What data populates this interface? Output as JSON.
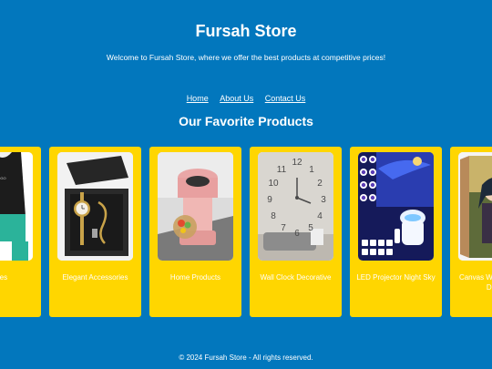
{
  "header": {
    "title": "Fursah Store",
    "tagline": "Welcome to Fursah Store, where we offer the best products at competitive prices!"
  },
  "nav": {
    "home": "Home",
    "about": "About Us",
    "contact": "Contact Us"
  },
  "products": {
    "heading": "Our Favorite Products",
    "items": [
      {
        "label": "Clothes",
        "image": "black-tank-top-photo"
      },
      {
        "label": "Elegant Accessories",
        "image": "gold-watch-gift-box-photo"
      },
      {
        "label": "Home Products",
        "image": "pink-blender-photo"
      },
      {
        "label": "Wall Clock Decorative",
        "image": "wall-clock-photo"
      },
      {
        "label": "LED Projector Night Sky",
        "image": "galaxy-projector-photo"
      },
      {
        "label": "Canvas Wall Anime Art Decor",
        "image": "anime-canvas-photo"
      }
    ]
  },
  "footer": {
    "text": "© 2024 Fursah Store - All rights reserved."
  },
  "colors": {
    "background": "#0277bd",
    "card": "#ffd600",
    "text": "#ffffff"
  }
}
